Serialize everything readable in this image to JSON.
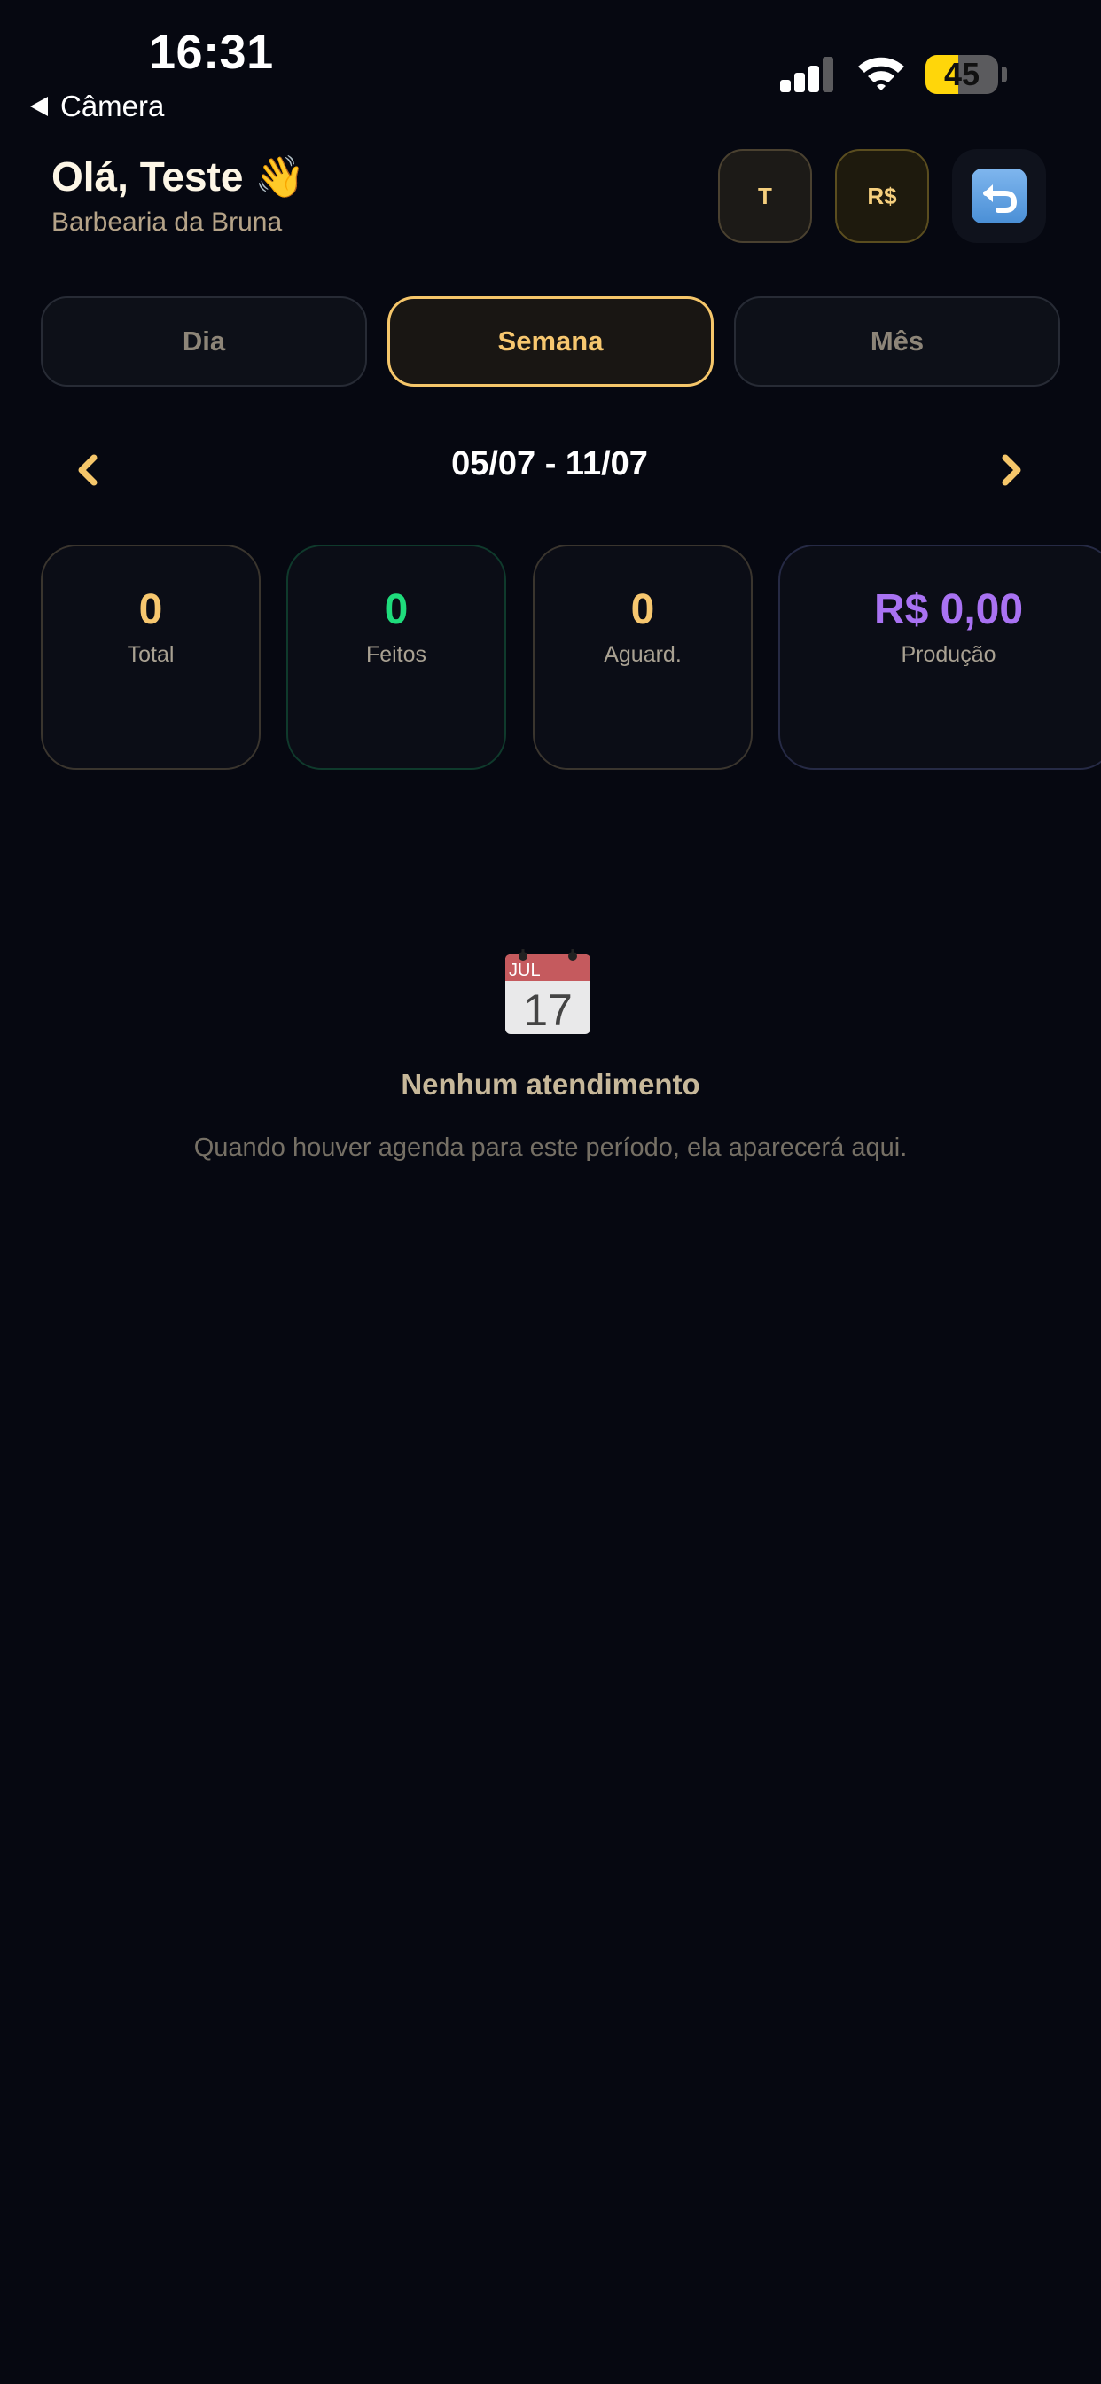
{
  "status_bar": {
    "time": "16:31",
    "back_label": "Câmera",
    "battery_level": "45",
    "battery_fraction": 0.45,
    "signal_icon": "cellular-signal-icon",
    "wifi_icon": "wifi-icon"
  },
  "header": {
    "greeting": "Olá, Teste 👋",
    "shop_name": "Barbearia da Bruna",
    "buttons": [
      {
        "label": "T"
      },
      {
        "label": "R$"
      },
      {
        "icon": "logout-return-icon"
      }
    ]
  },
  "period_tabs": [
    {
      "label": "Dia",
      "selected": false
    },
    {
      "label": "Semana",
      "selected": true
    },
    {
      "label": "Mês",
      "selected": false
    }
  ],
  "range_nav": {
    "label": "05/07 - 11/07",
    "prev_icon": "chevron-left-icon",
    "next_icon": "chevron-right-icon"
  },
  "stats": [
    {
      "value": "0",
      "label": "Total",
      "color": "#f7c76f"
    },
    {
      "value": "0",
      "label": "Feitos",
      "color": "#1fdc7c"
    },
    {
      "value": "0",
      "label": "Aguard.",
      "color": "#f7c76f"
    },
    {
      "value": "R$ 0,00",
      "label": "Produção",
      "color": "#a972f2"
    }
  ],
  "empty_state": {
    "icon": "calendar-icon",
    "calendar_month": "JUL",
    "calendar_day": "17",
    "title": "Nenhum atendimento",
    "description": "Quando houver agenda para este período, ela aparecerá aqui."
  },
  "colors": {
    "background": "#060811",
    "accent": "#f5c66a",
    "success": "#1fdc7c",
    "production": "#a972f2"
  }
}
